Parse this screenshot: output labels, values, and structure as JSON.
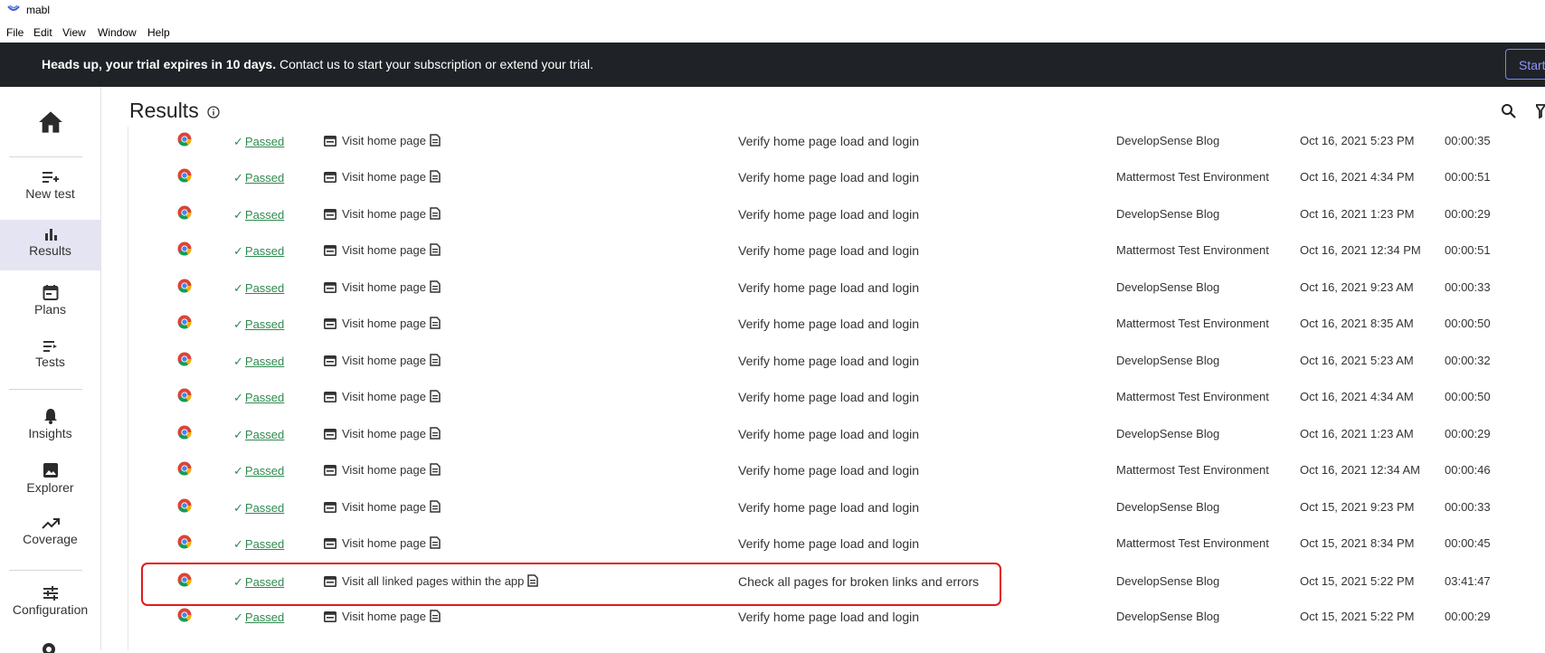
{
  "window": {
    "title": "mabl"
  },
  "menu": [
    "File",
    "Edit",
    "View",
    "Window",
    "Help"
  ],
  "banner": {
    "bold": "Heads up, your trial expires in 10 days.",
    "text": " Contact us to start your subscription or extend your trial.",
    "button": "Start"
  },
  "sidebar": {
    "items": [
      {
        "label": "",
        "icon": "home-icon"
      },
      {
        "label": "New test",
        "icon": "playlist-add-icon"
      },
      {
        "label": "Results",
        "icon": "bar-chart-icon",
        "active": true
      },
      {
        "label": "Plans",
        "icon": "calendar-icon"
      },
      {
        "label": "Tests",
        "icon": "list-arrow-icon"
      },
      {
        "label": "Insights",
        "icon": "bell-icon"
      },
      {
        "label": "Explorer",
        "icon": "image-icon"
      },
      {
        "label": "Coverage",
        "icon": "trending-up-icon"
      },
      {
        "label": "Configuration",
        "icon": "sliders-icon"
      }
    ]
  },
  "page": {
    "title": "Results"
  },
  "results": [
    {
      "status": "Passed",
      "test": "Visit home page",
      "plan": "Verify home page load and login",
      "env": "DevelopSense Blog",
      "date": "Oct 16, 2021 5:23 PM",
      "duration": "00:00:35"
    },
    {
      "status": "Passed",
      "test": "Visit home page",
      "plan": "Verify home page load and login",
      "env": "Mattermost Test Environment",
      "date": "Oct 16, 2021 4:34 PM",
      "duration": "00:00:51"
    },
    {
      "status": "Passed",
      "test": "Visit home page",
      "plan": "Verify home page load and login",
      "env": "DevelopSense Blog",
      "date": "Oct 16, 2021 1:23 PM",
      "duration": "00:00:29"
    },
    {
      "status": "Passed",
      "test": "Visit home page",
      "plan": "Verify home page load and login",
      "env": "Mattermost Test Environment",
      "date": "Oct 16, 2021 12:34 PM",
      "duration": "00:00:51"
    },
    {
      "status": "Passed",
      "test": "Visit home page",
      "plan": "Verify home page load and login",
      "env": "DevelopSense Blog",
      "date": "Oct 16, 2021 9:23 AM",
      "duration": "00:00:33"
    },
    {
      "status": "Passed",
      "test": "Visit home page",
      "plan": "Verify home page load and login",
      "env": "Mattermost Test Environment",
      "date": "Oct 16, 2021 8:35 AM",
      "duration": "00:00:50"
    },
    {
      "status": "Passed",
      "test": "Visit home page",
      "plan": "Verify home page load and login",
      "env": "DevelopSense Blog",
      "date": "Oct 16, 2021 5:23 AM",
      "duration": "00:00:32"
    },
    {
      "status": "Passed",
      "test": "Visit home page",
      "plan": "Verify home page load and login",
      "env": "Mattermost Test Environment",
      "date": "Oct 16, 2021 4:34 AM",
      "duration": "00:00:50"
    },
    {
      "status": "Passed",
      "test": "Visit home page",
      "plan": "Verify home page load and login",
      "env": "DevelopSense Blog",
      "date": "Oct 16, 2021 1:23 AM",
      "duration": "00:00:29"
    },
    {
      "status": "Passed",
      "test": "Visit home page",
      "plan": "Verify home page load and login",
      "env": "Mattermost Test Environment",
      "date": "Oct 16, 2021 12:34 AM",
      "duration": "00:00:46"
    },
    {
      "status": "Passed",
      "test": "Visit home page",
      "plan": "Verify home page load and login",
      "env": "DevelopSense Blog",
      "date": "Oct 15, 2021 9:23 PM",
      "duration": "00:00:33"
    },
    {
      "status": "Passed",
      "test": "Visit home page",
      "plan": "Verify home page load and login",
      "env": "Mattermost Test Environment",
      "date": "Oct 15, 2021 8:34 PM",
      "duration": "00:00:45"
    },
    {
      "status": "Passed",
      "test": "Visit all linked pages within the app",
      "plan": "Check all pages for broken links and errors",
      "env": "DevelopSense Blog",
      "date": "Oct 15, 2021 5:22 PM",
      "duration": "03:41:47",
      "highlighted": true
    },
    {
      "status": "Passed",
      "test": "Visit home page",
      "plan": "Verify home page load and login",
      "env": "DevelopSense Blog",
      "date": "Oct 15, 2021 5:22 PM",
      "duration": "00:00:29"
    }
  ],
  "colors": {
    "banner": "#1f2226",
    "passed": "#2f8a4f",
    "highlight": "#e21b1b",
    "active_nav": "#e4e4f2"
  }
}
